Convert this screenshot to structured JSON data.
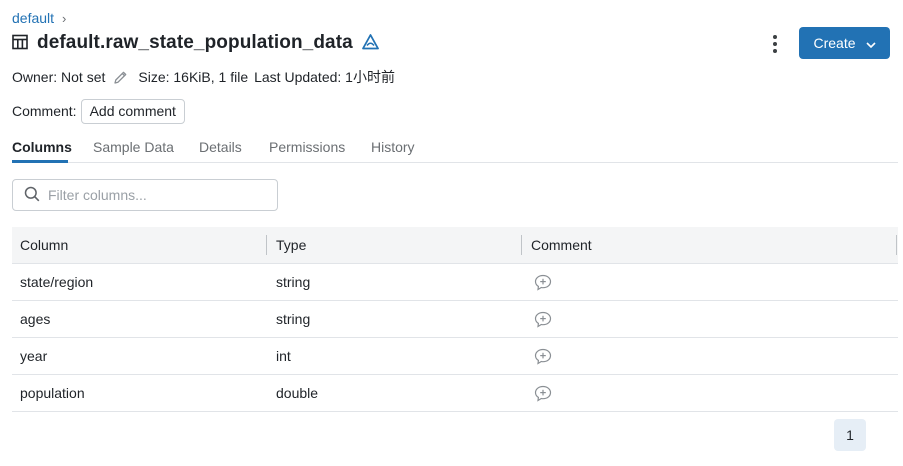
{
  "breadcrumb": {
    "schema": "default",
    "separator": "›"
  },
  "header": {
    "title": "default.raw_state_population_data"
  },
  "actions": {
    "create_label": "Create"
  },
  "meta": {
    "owner": "Owner: Not set",
    "size": "Size: 16KiB, 1 file",
    "last_updated": "Last Updated: 1小时前"
  },
  "comment": {
    "label": "Comment:",
    "add_label": "Add comment"
  },
  "tabs": [
    {
      "label": "Columns"
    },
    {
      "label": "Sample Data"
    },
    {
      "label": "Details"
    },
    {
      "label": "Permissions"
    },
    {
      "label": "History"
    }
  ],
  "filter": {
    "placeholder": "Filter columns..."
  },
  "table": {
    "headers": {
      "column": "Column",
      "type": "Type",
      "comment": "Comment"
    },
    "rows": [
      {
        "column": "state/region",
        "type": "string"
      },
      {
        "column": "ages",
        "type": "string"
      },
      {
        "column": "year",
        "type": "int"
      },
      {
        "column": "population",
        "type": "double"
      }
    ]
  },
  "pagination": {
    "current_page": "1"
  },
  "colors": {
    "accent": "#2272b4",
    "delta_icon": "#2272b4",
    "header_bg": "#f4f5f6",
    "pager_bg": "#e6eef6"
  },
  "icons": [
    "table-icon",
    "delta-icon",
    "kebab-icon",
    "chevron-down-icon",
    "pencil-icon",
    "search-icon",
    "add-comment-icon"
  ]
}
